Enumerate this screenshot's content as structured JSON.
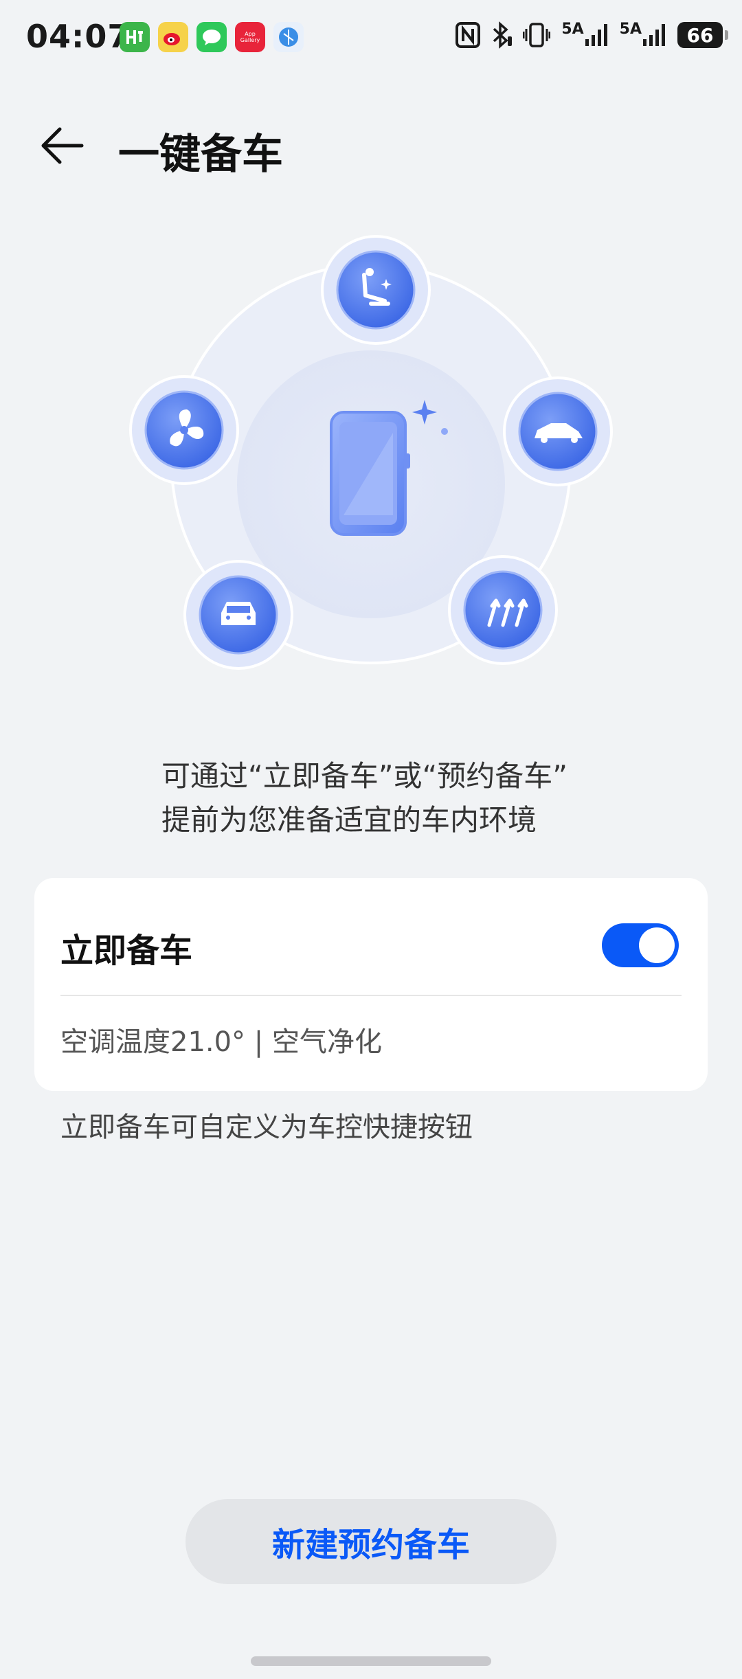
{
  "status_bar": {
    "time": "04:07",
    "apps": [
      {
        "icon": "green-app-icon",
        "color": "#3cb54a",
        "label": ""
      },
      {
        "icon": "weibo-icon",
        "color": "#f6d24a",
        "label": ""
      },
      {
        "icon": "messages-icon",
        "color": "#2ec85a",
        "label": ""
      },
      {
        "icon": "app-gallery-icon",
        "color": "#e8243a",
        "label": "App Gallery"
      },
      {
        "icon": "browser-icon",
        "color": "#3a8ee6",
        "label": ""
      }
    ],
    "network_1": "5A",
    "network_2": "5A",
    "battery": "66"
  },
  "header": {
    "title": "一键备车"
  },
  "illustration": {
    "icons": [
      "seat-icon",
      "car-side-icon",
      "defrost-icon",
      "car-front-icon",
      "fan-icon"
    ],
    "center": "phone-icon",
    "accent": "#4a78f0"
  },
  "description": {
    "line1": "可通过“立即备车”或“预约备车”",
    "line2": "提前为您准备适宜的车内环境"
  },
  "card": {
    "title": "立即备车",
    "toggle_on": true,
    "subtitle": "空调温度21.0° | 空气净化"
  },
  "helper_text": "立即备车可自定义为车控快捷按钮",
  "bottom_button": "新建预约备车",
  "colors": {
    "accent": "#0a59f7",
    "background": "#f1f3f5"
  }
}
